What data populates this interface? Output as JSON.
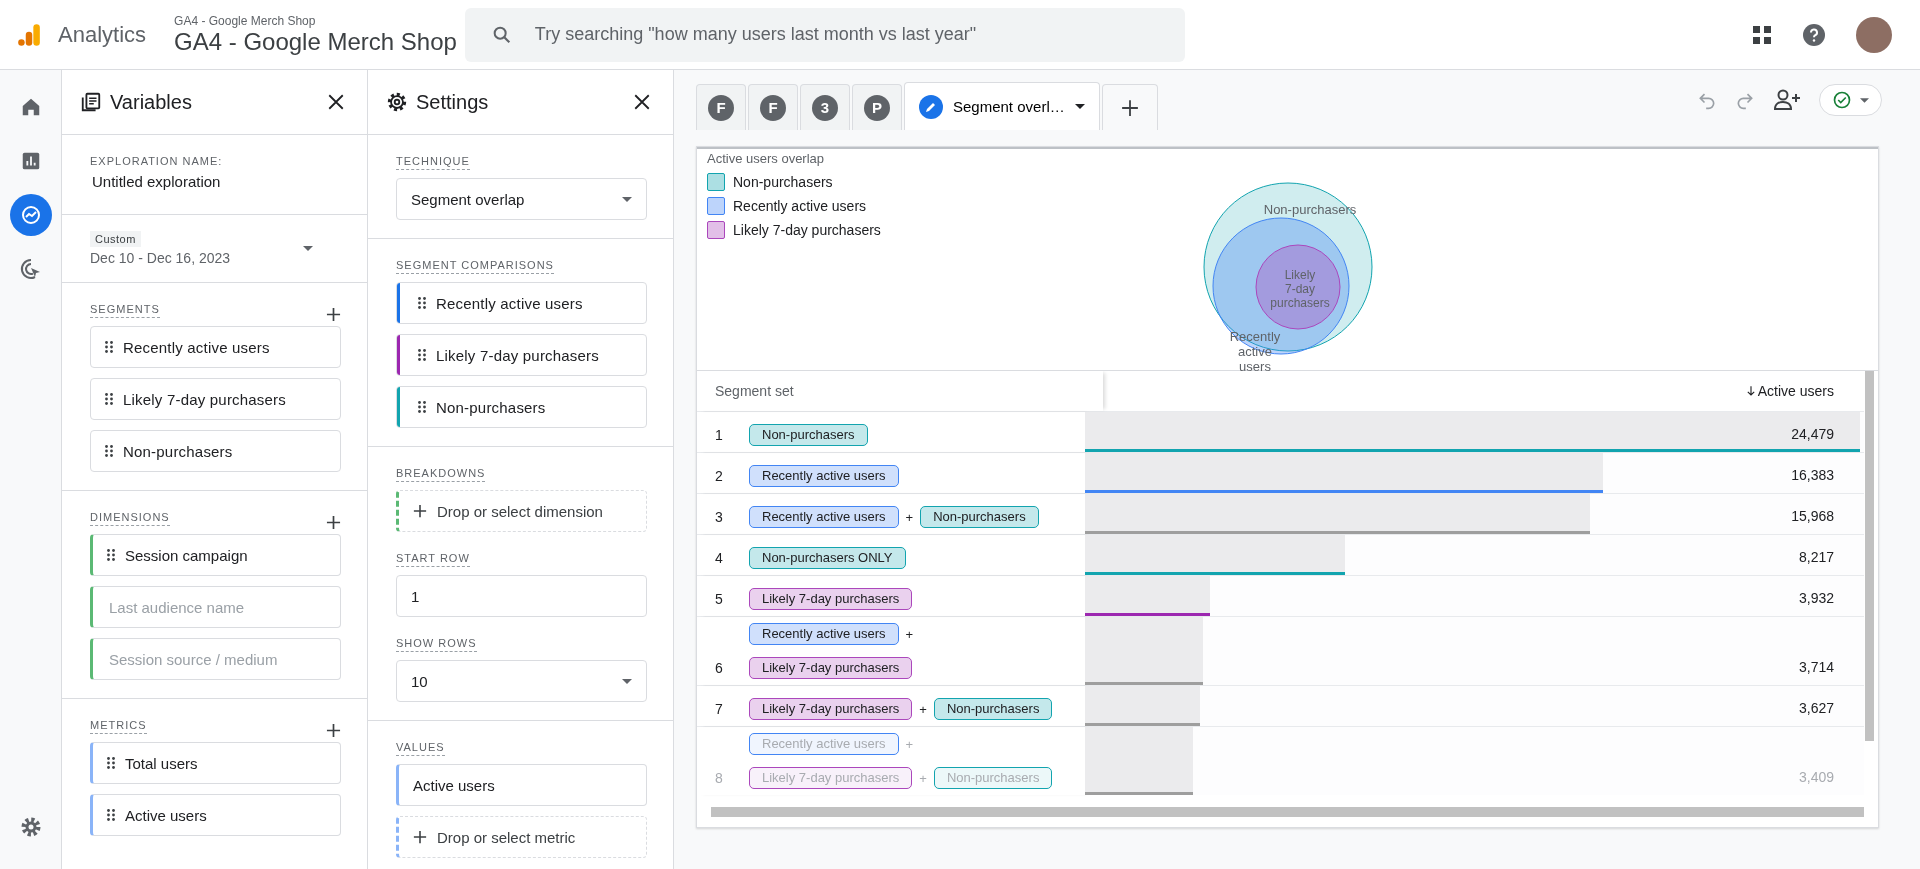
{
  "app_bar": {
    "product": "Analytics",
    "property_small": "GA4 - Google Merch Shop",
    "property": "GA4 - Google Merch Shop",
    "search": {
      "placeholder": "Try searching \"how many users last month vs last year\""
    }
  },
  "rail": [
    {
      "kind": "home",
      "selected": false
    },
    {
      "kind": "reports",
      "selected": false
    },
    {
      "kind": "explore",
      "selected": true
    },
    {
      "kind": "advertising",
      "selected": false
    }
  ],
  "variables": {
    "title": "Variables",
    "exploration_label": "EXPLORATION NAME:",
    "exploration_name": "Untitled exploration",
    "date_chip": "Custom",
    "date_range": "Dec 10 - Dec 16, 2023",
    "segments": {
      "label": "SEGMENTS",
      "items": [
        "Recently active users",
        "Likely 7-day purchasers",
        "Non-purchasers"
      ]
    },
    "dimensions": {
      "label": "DIMENSIONS",
      "items": [
        {
          "label": "Session campaign",
          "placeholder": false
        },
        {
          "label": "Last audience name",
          "placeholder": true
        },
        {
          "label": "Session source / medium",
          "placeholder": true
        }
      ]
    },
    "metrics": {
      "label": "METRICS",
      "items": [
        "Total users",
        "Active users"
      ]
    }
  },
  "settings": {
    "title": "Settings",
    "technique_label": "TECHNIQUE",
    "technique": "Segment overlap",
    "comparisons_label": "SEGMENT COMPARISONS",
    "comparisons": [
      {
        "label": "Recently active users",
        "color": "#1a73e8"
      },
      {
        "label": "Likely 7-day purchasers",
        "color": "#9c27b0"
      },
      {
        "label": "Non-purchasers",
        "color": "#12a4af"
      }
    ],
    "breakdowns_label": "BREAKDOWNS",
    "breakdowns_drop": "Drop or select dimension",
    "start_row_label": "START ROW",
    "start_row": "1",
    "show_rows_label": "SHOW ROWS",
    "show_rows": "10",
    "values_label": "VALUES",
    "values": [
      "Active users"
    ],
    "values_drop": "Drop or select metric"
  },
  "tabs": [
    {
      "label": "F",
      "kind": "letter",
      "selected": false
    },
    {
      "label": "F",
      "kind": "letter",
      "selected": false
    },
    {
      "label": "3",
      "kind": "letter",
      "selected": false
    },
    {
      "label": "P",
      "kind": "letter",
      "selected": false
    },
    {
      "label": "Segment overl…",
      "kind": "edit",
      "selected": true
    }
  ],
  "chart": {
    "title": "Active users overlap",
    "legend": [
      {
        "label": "Non-purchasers",
        "color": "#12a4af"
      },
      {
        "label": "Recently active users",
        "color": "#4285f4"
      },
      {
        "label": "Likely 7-day purchasers",
        "color": "#ab47bc"
      }
    ],
    "venn_labels": {
      "outer": "Non-purchasers",
      "inner": [
        "Likely",
        "7-day",
        "purchasers"
      ],
      "middle": [
        "Recently",
        "active",
        "users"
      ]
    }
  },
  "table": {
    "columns": [
      "Segment set",
      "Active users"
    ],
    "rows": [
      {
        "index": "1",
        "lines": [
          [
            {
              "kind": "chip",
              "label": "Non-purchasers",
              "color": "#12a4af"
            }
          ]
        ],
        "value": "24,479",
        "level": 1,
        "color": "#12a4af",
        "faded": false
      },
      {
        "index": "2",
        "lines": [
          [
            {
              "kind": "chip",
              "label": "Recently active users",
              "color": "#4285f4"
            }
          ]
        ],
        "value": "16,383",
        "level": 0.669,
        "color": "#4285f4",
        "faded": false
      },
      {
        "index": "3",
        "lines": [
          [
            {
              "kind": "chip",
              "label": "Recently active users",
              "color": "#4285f4"
            },
            {
              "kind": "plus",
              "label": "+"
            },
            {
              "kind": "chip",
              "label": "Non-purchasers",
              "color": "#12a4af"
            }
          ]
        ],
        "value": "15,968",
        "level": 0.652,
        "color": "#9e9e9e",
        "faded": false
      },
      {
        "index": "4",
        "lines": [
          [
            {
              "kind": "chip",
              "label": "Non-purchasers ONLY",
              "color": "#12a4af"
            }
          ]
        ],
        "value": "8,217",
        "level": 0.336,
        "color": "#12a4af",
        "faded": false
      },
      {
        "index": "5",
        "lines": [
          [
            {
              "kind": "chip",
              "label": "Likely 7-day purchasers",
              "color": "#ab47bc"
            }
          ]
        ],
        "value": "3,932",
        "level": 0.161,
        "color": "#9c27b0",
        "faded": false
      },
      {
        "index": "6",
        "lines": [
          [
            {
              "kind": "chip",
              "label": "Recently active users",
              "color": "#4285f4"
            },
            {
              "kind": "plus",
              "label": "+"
            }
          ],
          [
            {
              "kind": "chip",
              "label": "Likely 7-day purchasers",
              "color": "#ab47bc"
            }
          ]
        ],
        "value": "3,714",
        "level": 0.152,
        "color": "#9e9e9e",
        "faded": false
      },
      {
        "index": "7",
        "lines": [
          [
            {
              "kind": "chip",
              "label": "Likely 7-day purchasers",
              "color": "#ab47bc"
            },
            {
              "kind": "plus",
              "label": "+"
            },
            {
              "kind": "chip",
              "label": "Non-purchasers",
              "color": "#12a4af"
            }
          ]
        ],
        "value": "3,627",
        "level": 0.148,
        "color": "#9e9e9e",
        "faded": false
      },
      {
        "index": "8",
        "lines": [
          [
            {
              "kind": "chip",
              "label": "Recently active users",
              "color": "#4285f4"
            },
            {
              "kind": "plus",
              "label": "+"
            }
          ],
          [
            {
              "kind": "chip",
              "label": "Likely 7-day purchasers",
              "color": "#ab47bc"
            },
            {
              "kind": "plus",
              "label": "+"
            },
            {
              "kind": "chip",
              "label": "Non-purchasers",
              "color": "#12a4af"
            }
          ]
        ],
        "value": "3,409",
        "level": 0.139,
        "color": "#9e9e9e",
        "faded": true
      }
    ]
  }
}
